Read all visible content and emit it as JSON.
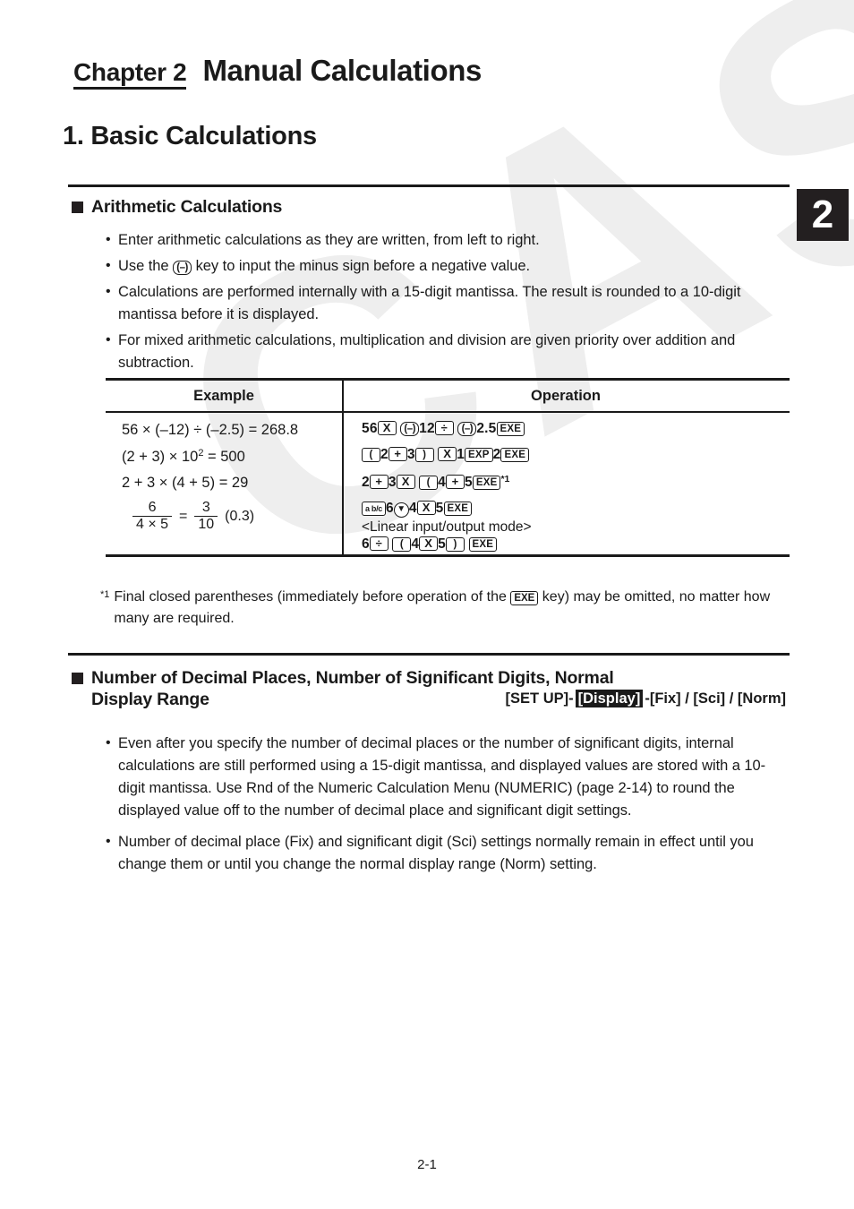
{
  "chapter": {
    "label": "Chapter 2",
    "title": "Manual Calculations",
    "tab_number": "2"
  },
  "section": {
    "number_title": "1. Basic Calculations"
  },
  "headings": {
    "arithmetic": "Arithmetic Calculations",
    "decimal_line1": "Number of Decimal Places, Number of Significant Digits, Normal",
    "decimal_line2": "Display Range"
  },
  "bullets_arithmetic": [
    "Enter arithmetic calculations as they are written, from left to right.",
    {
      "before": "Use the",
      "key": "(–)",
      "after": "key to input the minus sign before a negative value."
    },
    "Calculations are performed internally with a 15-digit mantissa. The result is rounded to a 10-digit mantissa before it is displayed.",
    "For mixed arithmetic calculations, multiplication and division are given priority over addition and subtraction."
  ],
  "table": {
    "headers": [
      "Example",
      "Operation"
    ],
    "rows": [
      {
        "example": "56 × (–12) ÷ (–2.5) = 268.8",
        "operation_keys": [
          "56",
          "X",
          "(–)",
          "12",
          "÷",
          "(–)",
          "2.5",
          "EXE"
        ]
      },
      {
        "example": "(2 + 3) × 10² = 500",
        "operation_keys": [
          "(",
          "2",
          "+",
          "3",
          ")",
          "X",
          "1",
          "EXP",
          "2",
          "EXE"
        ]
      },
      {
        "example": "2 + 3 × (4 + 5) = 29",
        "operation_keys": [
          "2",
          "+",
          "3",
          "X",
          "(",
          "4",
          "+",
          "5",
          "EXE"
        ],
        "footnote_mark": "*1"
      },
      {
        "example_fraction": {
          "num1": "6",
          "den1": "4 × 5",
          "equals": "=",
          "num2": "3",
          "den2": "10",
          "tail": "(0.3)"
        },
        "operation_keys": [
          "a b/c",
          "6",
          "▼",
          "4",
          "X",
          "5",
          "EXE"
        ],
        "mode_note": "<Linear input/output mode>",
        "operation_keys_linear": [
          "6",
          "÷",
          "(",
          "4",
          "X",
          "5",
          ")",
          "EXE"
        ]
      }
    ]
  },
  "footnote": {
    "mark": "*1",
    "before": "Final closed parentheses (immediately before operation of the",
    "key": "EXE",
    "after": "key) may be omitted, no matter how many are required."
  },
  "setup_path": {
    "prefix": "[SET UP]-",
    "highlight": "[Display]",
    "suffix": "-[Fix] / [Sci] / [Norm]"
  },
  "bullets_decimal": [
    "Even after you specify the number of decimal places or the number of significant digits, internal calculations are still performed using a 15-digit mantissa, and displayed values are stored with a 10-digit mantissa. Use Rnd of the Numeric Calculation Menu (NUMERIC) (page 2-14) to round the displayed value off to the number of decimal place and significant digit settings.",
    "Number of decimal place (Fix) and significant digit (Sci) settings normally remain in effect until you change them or until you change the normal display range (Norm) setting."
  ],
  "footer": {
    "page_number": "2-1"
  },
  "watermark": {
    "text": "CASIO"
  },
  "colors": {
    "ink": "#1a1a1a",
    "tab_bg": "#231f20",
    "watermark": "#eeeeee"
  }
}
